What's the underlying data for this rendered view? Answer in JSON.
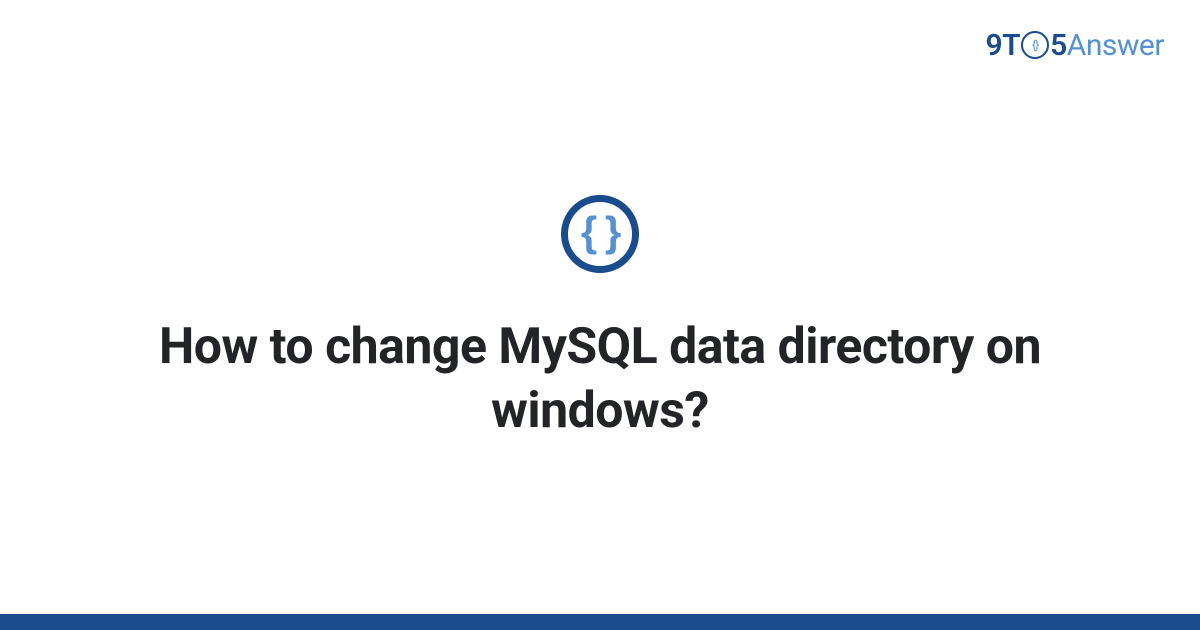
{
  "brand": {
    "part1": "9T",
    "part2": "5",
    "part3": "Answer",
    "clock_inner": "{}"
  },
  "icon": {
    "braces": "{ }"
  },
  "question": {
    "title": "How to change MySQL data directory on windows?"
  }
}
